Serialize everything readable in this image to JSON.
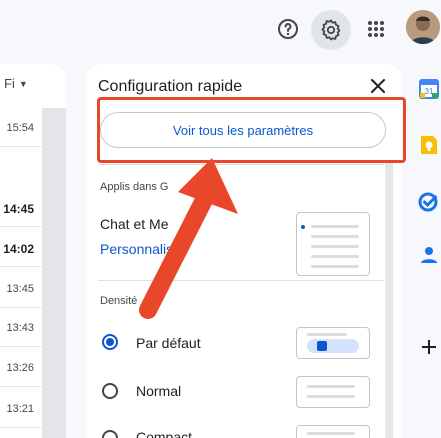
{
  "topbar": {
    "icons": [
      "help-icon",
      "settings-gear-icon",
      "apps-grid-icon",
      "account-avatar"
    ]
  },
  "maillist": {
    "filter_label": "Fi",
    "times": [
      {
        "text": "15:54",
        "bold": false
      },
      {
        "text": "14:45",
        "bold": true
      },
      {
        "text": "14:02",
        "bold": true
      },
      {
        "text": "13:45",
        "bold": false
      },
      {
        "text": "13:43",
        "bold": false
      },
      {
        "text": "13:26",
        "bold": false
      },
      {
        "text": "13:21",
        "bold": false
      }
    ]
  },
  "quick_settings": {
    "title": "Configuration rapide",
    "see_all_button": "Voir tous les paramètres",
    "apps_section": "Applis dans G",
    "chat_label": "Chat et Me",
    "customize_link": "Personnaliser",
    "density_section": "Densité",
    "density_options": [
      {
        "label": "Par défaut",
        "selected": true
      },
      {
        "label": "Normal",
        "selected": false
      },
      {
        "label": "Compact",
        "selected": false
      }
    ]
  },
  "annotation": {
    "color": "#e8472a"
  },
  "colors": {
    "accent": "#0b57d0"
  }
}
